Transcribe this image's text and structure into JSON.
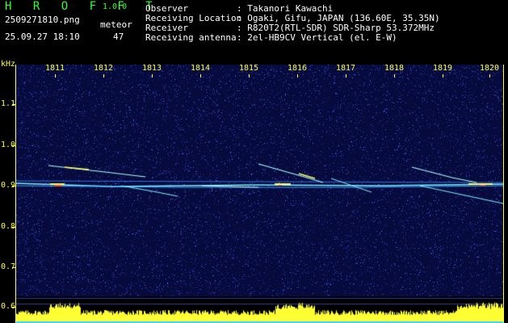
{
  "app": {
    "title": "H R O F F T",
    "version": "1.0.0"
  },
  "file": {
    "name": "2509271810.png",
    "datetime": "25.09.27 18:10",
    "meteor_label": "meteor",
    "meteor_count": "47"
  },
  "info": [
    {
      "key": "Observer",
      "value": ": Takanori Kawachi"
    },
    {
      "key": "Receiving Location",
      "value": ": Ogaki, Gifu, JAPAN (136.60E, 35.35N)"
    },
    {
      "key": "Receiver",
      "value": ": R820T2(RTL-SDR) SDR-Sharp 53.372MHz"
    },
    {
      "key": "Receiving antenna",
      "value": ": 2el-HB9CV Vertical (el. E-W)"
    }
  ],
  "axis": {
    "y_unit": "kHz",
    "y_ticks": [
      "1.1",
      "1.0",
      "0.9",
      "0.8",
      "0.7",
      "0.6"
    ],
    "x_ticks": [
      "1811",
      "1812",
      "1813",
      "1814",
      "1815",
      "1816",
      "1817",
      "1818",
      "1819",
      "1820"
    ],
    "freq_range_khz": [
      0.6,
      1.2
    ],
    "lower_band_ticks": [
      "0.6"
    ]
  },
  "colors": {
    "background": "#000000",
    "spectrogram_bg": "#070a3c",
    "noise_dot": "#2d4bd6",
    "signal_cyan": "#a8ffff",
    "signal_yellow": "#ffff66",
    "signal_red": "#ff4040",
    "histogram": "#ffff33",
    "label_green": "#33ff33",
    "label_yellow": "#ffff33"
  }
}
